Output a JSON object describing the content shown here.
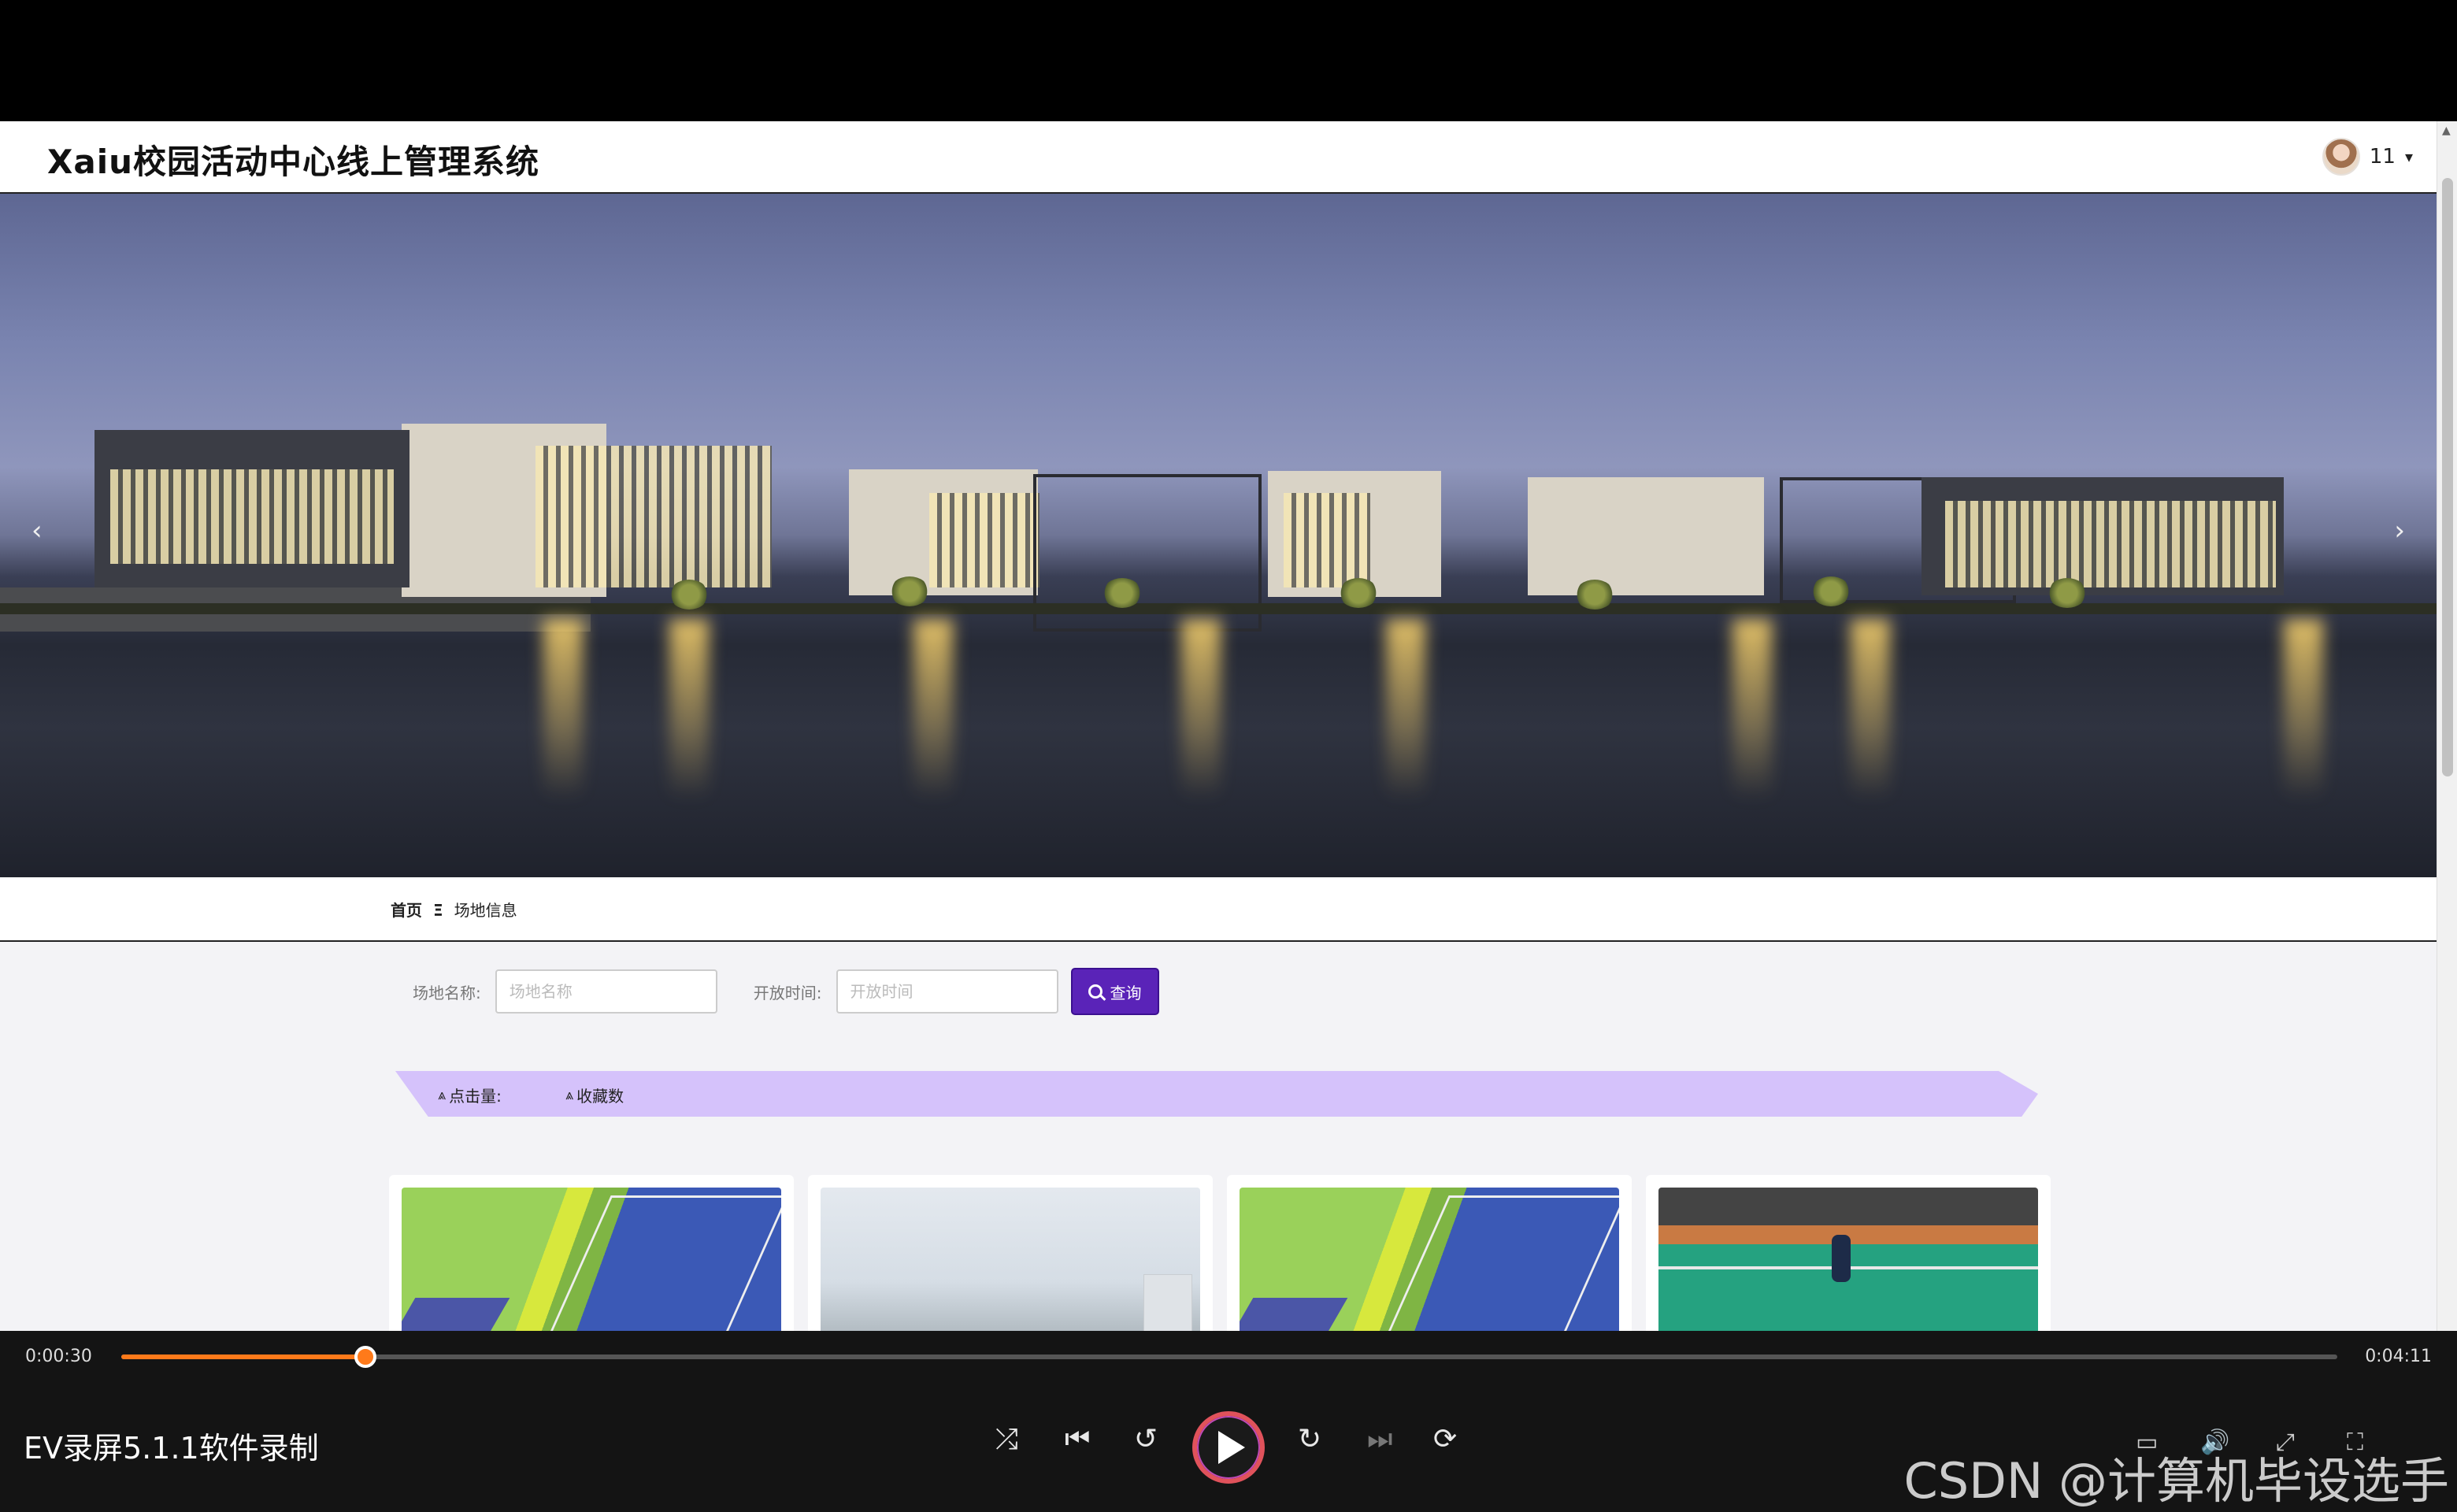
{
  "header": {
    "title": "Xaiu校园活动中心线上管理系统",
    "username": "11",
    "caret": "▾"
  },
  "banner": {
    "prev": "‹",
    "next": "›"
  },
  "breadcrumb": {
    "home": "首页",
    "separator": "Ξ",
    "current": "场地信息"
  },
  "search": {
    "name_label": "场地名称:",
    "name_placeholder": "场地名称",
    "time_label": "开放时间:",
    "time_placeholder": "开放时间",
    "query_label": "查询"
  },
  "sort": {
    "clicks": "点击量:",
    "favorites": "收藏数",
    "icon": "⩓"
  },
  "player": {
    "current_time": "0:00:30",
    "total_time": "0:04:11",
    "progress": 0.11,
    "recorder_label": "EV录屏5.1.1软件录制",
    "accent": "#ff7a1a",
    "icons": {
      "shuffle": "⤮",
      "prev": "⏮",
      "back10": "↺",
      "fwd30": "↻",
      "next": "⏭",
      "repeat": "⟳",
      "caption": "▭",
      "volume": "🔊",
      "expand": "⤢",
      "fullscreen": "⛶"
    }
  },
  "watermark": "CSDN @计算机毕设选手",
  "colors": {
    "primary": "#5a23b8",
    "sort_bar": "#d5c2fb"
  }
}
